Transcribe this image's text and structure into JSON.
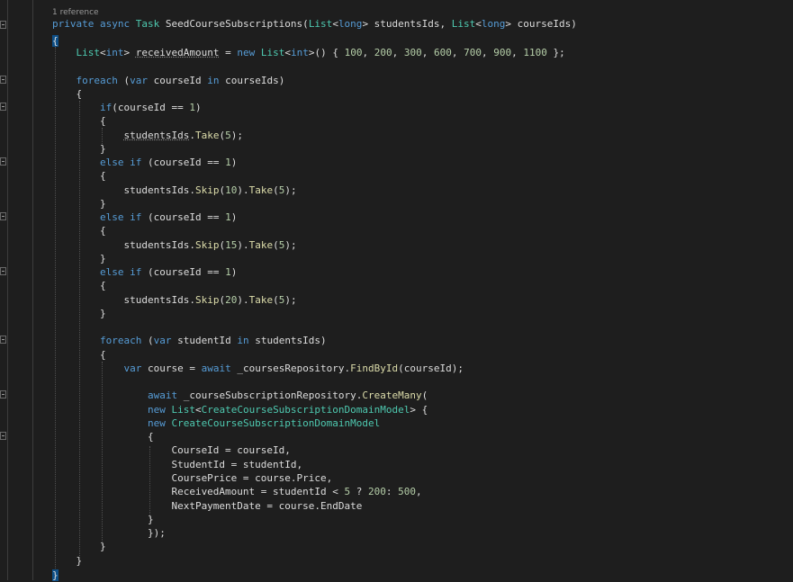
{
  "codelens": "1 reference",
  "lines": [
    [
      {
        "t": "private",
        "c": "kw"
      },
      {
        "t": " "
      },
      {
        "t": "async",
        "c": "kw"
      },
      {
        "t": " "
      },
      {
        "t": "Task",
        "c": "ty"
      },
      {
        "t": " SeedCourseSubscriptions("
      },
      {
        "t": "List",
        "c": "ty"
      },
      {
        "t": "<"
      },
      {
        "t": "long",
        "c": "kw"
      },
      {
        "t": "> studentsIds, "
      },
      {
        "t": "List",
        "c": "ty"
      },
      {
        "t": "<"
      },
      {
        "t": "long",
        "c": "kw"
      },
      {
        "t": "> courseIds)"
      }
    ],
    [
      {
        "t": "{",
        "c": "brace"
      }
    ],
    [
      {
        "t": "    "
      },
      {
        "t": "List",
        "c": "ty"
      },
      {
        "t": "<"
      },
      {
        "t": "int",
        "c": "kw"
      },
      {
        "t": "> "
      },
      {
        "t": "receivedAmount",
        "c": "sq"
      },
      {
        "t": " = "
      },
      {
        "t": "new",
        "c": "kw"
      },
      {
        "t": " "
      },
      {
        "t": "List",
        "c": "ty"
      },
      {
        "t": "<"
      },
      {
        "t": "int",
        "c": "kw"
      },
      {
        "t": ">() { "
      },
      {
        "t": "100",
        "c": "nu"
      },
      {
        "t": ", "
      },
      {
        "t": "200",
        "c": "nu"
      },
      {
        "t": ", "
      },
      {
        "t": "300",
        "c": "nu"
      },
      {
        "t": ", "
      },
      {
        "t": "600",
        "c": "nu"
      },
      {
        "t": ", "
      },
      {
        "t": "700",
        "c": "nu"
      },
      {
        "t": ", "
      },
      {
        "t": "900",
        "c": "nu"
      },
      {
        "t": ", "
      },
      {
        "t": "1100",
        "c": "nu"
      },
      {
        "t": " };"
      }
    ],
    [],
    [
      {
        "t": "    "
      },
      {
        "t": "foreach",
        "c": "kw"
      },
      {
        "t": " ("
      },
      {
        "t": "var",
        "c": "kw"
      },
      {
        "t": " courseId "
      },
      {
        "t": "in",
        "c": "kw"
      },
      {
        "t": " courseIds)"
      }
    ],
    [
      {
        "t": "    {"
      }
    ],
    [
      {
        "t": "        "
      },
      {
        "t": "if",
        "c": "kw"
      },
      {
        "t": "(courseId == "
      },
      {
        "t": "1",
        "c": "nu"
      },
      {
        "t": ")"
      }
    ],
    [
      {
        "t": "        {"
      }
    ],
    [
      {
        "t": "            "
      },
      {
        "t": "studentsIds",
        "c": "sq"
      },
      {
        "t": "."
      },
      {
        "t": "Take",
        "c": "fn"
      },
      {
        "t": "("
      },
      {
        "t": "5",
        "c": "nu"
      },
      {
        "t": ");"
      }
    ],
    [
      {
        "t": "        }"
      }
    ],
    [
      {
        "t": "        "
      },
      {
        "t": "else",
        "c": "kw"
      },
      {
        "t": " "
      },
      {
        "t": "if",
        "c": "kw"
      },
      {
        "t": " (courseId == "
      },
      {
        "t": "1",
        "c": "nu"
      },
      {
        "t": ")"
      }
    ],
    [
      {
        "t": "        {"
      }
    ],
    [
      {
        "t": "            studentsIds."
      },
      {
        "t": "Skip",
        "c": "fn"
      },
      {
        "t": "("
      },
      {
        "t": "10",
        "c": "nu"
      },
      {
        "t": ")."
      },
      {
        "t": "Take",
        "c": "fn"
      },
      {
        "t": "("
      },
      {
        "t": "5",
        "c": "nu"
      },
      {
        "t": ");"
      }
    ],
    [
      {
        "t": "        }"
      }
    ],
    [
      {
        "t": "        "
      },
      {
        "t": "else",
        "c": "kw"
      },
      {
        "t": " "
      },
      {
        "t": "if",
        "c": "kw"
      },
      {
        "t": " (courseId == "
      },
      {
        "t": "1",
        "c": "nu"
      },
      {
        "t": ")"
      }
    ],
    [
      {
        "t": "        {"
      }
    ],
    [
      {
        "t": "            studentsIds."
      },
      {
        "t": "Skip",
        "c": "fn"
      },
      {
        "t": "("
      },
      {
        "t": "15",
        "c": "nu"
      },
      {
        "t": ")."
      },
      {
        "t": "Take",
        "c": "fn"
      },
      {
        "t": "("
      },
      {
        "t": "5",
        "c": "nu"
      },
      {
        "t": ");"
      }
    ],
    [
      {
        "t": "        }"
      }
    ],
    [
      {
        "t": "        "
      },
      {
        "t": "else",
        "c": "kw"
      },
      {
        "t": " "
      },
      {
        "t": "if",
        "c": "kw"
      },
      {
        "t": " (courseId == "
      },
      {
        "t": "1",
        "c": "nu"
      },
      {
        "t": ")"
      }
    ],
    [
      {
        "t": "        {"
      }
    ],
    [
      {
        "t": "            studentsIds."
      },
      {
        "t": "Skip",
        "c": "fn"
      },
      {
        "t": "("
      },
      {
        "t": "20",
        "c": "nu"
      },
      {
        "t": ")."
      },
      {
        "t": "Take",
        "c": "fn"
      },
      {
        "t": "("
      },
      {
        "t": "5",
        "c": "nu"
      },
      {
        "t": ");"
      }
    ],
    [
      {
        "t": "        }"
      }
    ],
    [],
    [
      {
        "t": "        "
      },
      {
        "t": "foreach",
        "c": "kw"
      },
      {
        "t": " ("
      },
      {
        "t": "var",
        "c": "kw"
      },
      {
        "t": " studentId "
      },
      {
        "t": "in",
        "c": "kw"
      },
      {
        "t": " studentsIds)"
      }
    ],
    [
      {
        "t": "        {"
      }
    ],
    [
      {
        "t": "            "
      },
      {
        "t": "var",
        "c": "kw"
      },
      {
        "t": " course = "
      },
      {
        "t": "await",
        "c": "kw"
      },
      {
        "t": " _coursesRepository."
      },
      {
        "t": "FindById",
        "c": "fn"
      },
      {
        "t": "(courseId);"
      }
    ],
    [],
    [
      {
        "t": "                "
      },
      {
        "t": "await",
        "c": "kw"
      },
      {
        "t": " _courseSubscriptionRepository."
      },
      {
        "t": "CreateMany",
        "c": "fn"
      },
      {
        "t": "("
      }
    ],
    [
      {
        "t": "                "
      },
      {
        "t": "new",
        "c": "kw"
      },
      {
        "t": " "
      },
      {
        "t": "List",
        "c": "ty"
      },
      {
        "t": "<"
      },
      {
        "t": "CreateCourseSubscriptionDomainModel",
        "c": "ty"
      },
      {
        "t": "> {"
      }
    ],
    [
      {
        "t": "                "
      },
      {
        "t": "new",
        "c": "kw"
      },
      {
        "t": " "
      },
      {
        "t": "CreateCourseSubscriptionDomainModel",
        "c": "ty"
      }
    ],
    [
      {
        "t": "                {"
      }
    ],
    [
      {
        "t": "                    CourseId = courseId,"
      }
    ],
    [
      {
        "t": "                    StudentId = studentId,"
      }
    ],
    [
      {
        "t": "                    CoursePrice = course.Price,"
      }
    ],
    [
      {
        "t": "                    ReceivedAmount = studentId < "
      },
      {
        "t": "5",
        "c": "nu"
      },
      {
        "t": " ? "
      },
      {
        "t": "200",
        "c": "nu"
      },
      {
        "t": ": "
      },
      {
        "t": "500",
        "c": "nu"
      },
      {
        "t": ","
      }
    ],
    [
      {
        "t": "                    NextPaymentDate = course.EndDate"
      }
    ],
    [
      {
        "t": "                }"
      }
    ],
    [
      {
        "t": "                });"
      }
    ],
    [
      {
        "t": "        }"
      }
    ],
    [
      {
        "t": "    }"
      }
    ],
    [
      {
        "t": "}",
        "c": "brace"
      }
    ]
  ]
}
